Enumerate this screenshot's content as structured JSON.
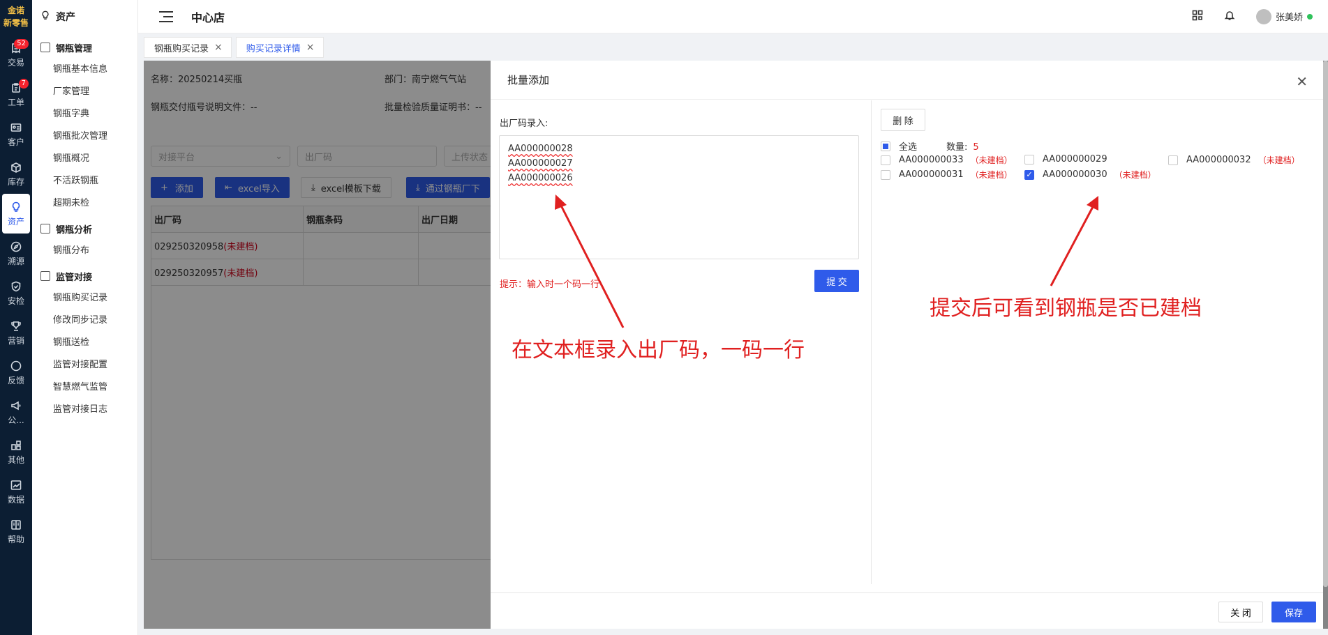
{
  "brand": {
    "line1": "金诺",
    "line2": "新零售"
  },
  "rail": [
    {
      "key": "trade",
      "label": "交易",
      "icon": "receipt-icon",
      "badge": "52"
    },
    {
      "key": "workorder",
      "label": "工单",
      "icon": "clipboard-icon",
      "badge": "7"
    },
    {
      "key": "customer",
      "label": "客户",
      "icon": "id-card-icon",
      "badge": ""
    },
    {
      "key": "inventory",
      "label": "库存",
      "icon": "box-icon",
      "badge": ""
    },
    {
      "key": "asset",
      "label": "资产",
      "icon": "lightbulb-icon",
      "badge": "",
      "active": true
    },
    {
      "key": "trace",
      "label": "溯源",
      "icon": "compass-icon",
      "badge": ""
    },
    {
      "key": "safety",
      "label": "安检",
      "icon": "shield-check-icon",
      "badge": ""
    },
    {
      "key": "marketing",
      "label": "营销",
      "icon": "trophy-icon",
      "badge": ""
    },
    {
      "key": "feedback",
      "label": "反馈",
      "icon": "chat-icon",
      "badge": ""
    },
    {
      "key": "notice",
      "label": "公...",
      "icon": "megaphone-icon",
      "badge": ""
    },
    {
      "key": "other",
      "label": "其他",
      "icon": "grid-icon",
      "badge": ""
    },
    {
      "key": "data",
      "label": "数据",
      "icon": "chart-icon",
      "badge": ""
    },
    {
      "key": "help",
      "label": "帮助",
      "icon": "book-icon",
      "badge": ""
    }
  ],
  "submenu": {
    "title": "资产",
    "groups": [
      {
        "label": "钢瓶管理",
        "items": [
          "钢瓶基本信息",
          "厂家管理",
          "钢瓶字典",
          "钢瓶批次管理",
          "钢瓶概况",
          "不活跃钢瓶",
          "超期未检"
        ]
      },
      {
        "label": "钢瓶分析",
        "items": [
          "钢瓶分布"
        ]
      },
      {
        "label": "监管对接",
        "items": [
          "钢瓶购买记录",
          "修改同步记录",
          "钢瓶送检",
          "监管对接配置",
          "智慧燃气监管",
          "监管对接日志"
        ]
      }
    ]
  },
  "header": {
    "store": "中心店",
    "user": "张美娇"
  },
  "tabs": [
    {
      "label": "钢瓶购买记录",
      "active": false
    },
    {
      "label": "购买记录详情",
      "active": true
    }
  ],
  "detail": {
    "name_line": "名称：20250214买瓶",
    "dept_line": "部门：南宁燃气气站",
    "file_line": "钢瓶交付瓶号说明文件：--",
    "cert_line": "批量检验质量证明书：--",
    "filter_platform": "对接平台",
    "filter_code": "出厂码",
    "filter_upload": "上传状态",
    "btn_add": "添加",
    "btn_import": "excel导入",
    "btn_template": "excel模板下载",
    "btn_via": "通过钢瓶厂下",
    "table": {
      "headers": [
        "出厂码",
        "钢瓶条码",
        "出厂日期"
      ],
      "rows": [
        {
          "code": "029250320958",
          "status": "(未建档)"
        },
        {
          "code": "029250320957",
          "status": "(未建档)"
        }
      ]
    }
  },
  "drawer": {
    "title": "批量添加",
    "input_label": "出厂码录入:",
    "textarea_value": "AA000000028\nAA000000027\nAA000000026",
    "hint": "提示：输入时一个码一行",
    "submit": "提 交",
    "delete": "删 除",
    "select_all": "全选",
    "count_label": "数量:",
    "count_value": "5",
    "codes": [
      {
        "code": "AA000000033",
        "status": "（未建档）",
        "checked": false
      },
      {
        "code": "AA000000029",
        "status": "",
        "checked": false
      },
      {
        "code": "AA000000032",
        "status": "（未建档）",
        "checked": false
      },
      {
        "code": "AA000000031",
        "status": "（未建档）",
        "checked": false
      },
      {
        "code": "AA000000030",
        "status": "（未建档）",
        "checked": true
      }
    ],
    "close": "关 闭",
    "save": "保存"
  },
  "annotations": {
    "left": "在文本框录入出厂码，一码一行",
    "right": "提交后可看到钢瓶是否已建档"
  },
  "colors": {
    "primary": "#2f5bea",
    "rail_bg": "#0c1e33",
    "alert": "#e02020"
  }
}
